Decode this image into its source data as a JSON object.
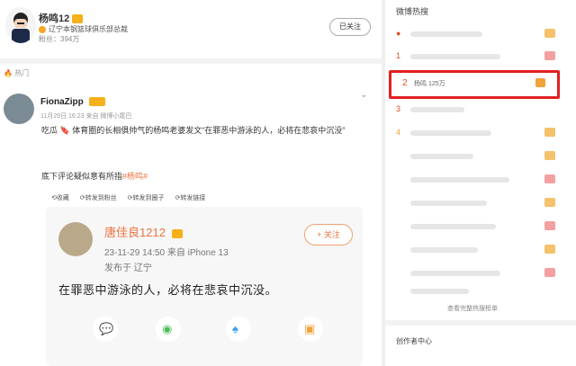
{
  "top_user": {
    "name": "杨鸣12",
    "description": "辽宁本钢篮球俱乐部总裁",
    "fans": "粉丝：394万",
    "followed_label": "已关注"
  },
  "feed_label": "热门",
  "post": {
    "author": "FionaZipp",
    "meta": "11月29日 16:23  来自 微博小尾巴",
    "text_line1": "吃瓜 🔖 体育圈的长相俱帅气的杨鸣老婆发文“在罪恶中游泳的人，必将在悲哀中沉没”",
    "text_line2_prefix": "底下评论疑似意有所指",
    "text_line2_tag": "#杨鸣#",
    "actions": [
      "转发",
      "评论",
      "赞"
    ],
    "actions_display": [
      "⟲收藏",
      "⟳转发到粉丝",
      "⟳转发到圈子",
      "⟳转发链接"
    ]
  },
  "repost": {
    "name": "唐佳良1212",
    "meta1": "23-11-29 14:50  来自 iPhone 13",
    "meta2": "发布于 辽宁",
    "follow_label": "+ 关注",
    "text": "在罪恶中游泳的人，必将在悲哀中沉没。",
    "share_icons": [
      "wechat-icon",
      "moments-icon",
      "qq-icon",
      "bookmark-icon"
    ]
  },
  "sidebar": {
    "title": "微博热搜",
    "highlight_rank": "2",
    "highlight_text": "杨鸣  125万",
    "more_label": "查看完整热搜榜单",
    "creator_label": "创作者中心",
    "ranks": [
      "",
      "1",
      "",
      "3",
      "",
      "4",
      "",
      "",
      "",
      "",
      "",
      "",
      ""
    ]
  },
  "colors": {
    "accent": "#eb7340",
    "highlight_border": "#e02020"
  }
}
